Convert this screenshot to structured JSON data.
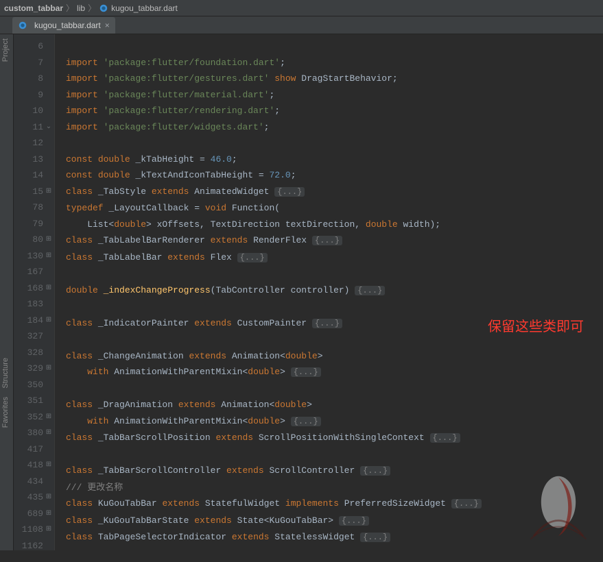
{
  "breadcrumb": {
    "root": "custom_tabbar",
    "folder": "lib",
    "file": "kugou_tabbar.dart"
  },
  "tab": {
    "label": "kugou_tabbar.dart"
  },
  "sideTools": {
    "project": "Project",
    "structure": "Structure",
    "favorites": "Favorites"
  },
  "annotation": "保留这些类即可",
  "lines": [
    {
      "num": "6",
      "fold": "",
      "segs": []
    },
    {
      "num": "7",
      "fold": "",
      "segs": [
        {
          "c": "kwd",
          "t": "import "
        },
        {
          "c": "str",
          "t": "'package:flutter/foundation.dart'"
        },
        {
          "c": "punct",
          "t": ";"
        }
      ]
    },
    {
      "num": "8",
      "fold": "",
      "segs": [
        {
          "c": "kwd",
          "t": "import "
        },
        {
          "c": "str",
          "t": "'package:flutter/gestures.dart'"
        },
        {
          "c": "kwd",
          "t": " show "
        },
        {
          "c": "typ",
          "t": "DragStartBehavior"
        },
        {
          "c": "punct",
          "t": ";"
        }
      ]
    },
    {
      "num": "9",
      "fold": "",
      "segs": [
        {
          "c": "kwd",
          "t": "import "
        },
        {
          "c": "str",
          "t": "'package:flutter/material.dart'"
        },
        {
          "c": "punct",
          "t": ";"
        }
      ]
    },
    {
      "num": "10",
      "fold": "",
      "segs": [
        {
          "c": "kwd",
          "t": "import "
        },
        {
          "c": "str",
          "t": "'package:flutter/rendering.dart'"
        },
        {
          "c": "punct",
          "t": ";"
        }
      ]
    },
    {
      "num": "11",
      "fold": "⌄",
      "segs": [
        {
          "c": "kwd",
          "t": "import "
        },
        {
          "c": "str",
          "t": "'package:flutter/widgets.dart'"
        },
        {
          "c": "punct",
          "t": ";"
        }
      ]
    },
    {
      "num": "12",
      "fold": "",
      "segs": []
    },
    {
      "num": "13",
      "fold": "",
      "segs": [
        {
          "c": "kwd",
          "t": "const "
        },
        {
          "c": "kwd",
          "t": "double "
        },
        {
          "c": "typ",
          "t": "_kTabHeight = "
        },
        {
          "c": "num",
          "t": "46.0"
        },
        {
          "c": "punct",
          "t": ";"
        }
      ]
    },
    {
      "num": "14",
      "fold": "",
      "segs": [
        {
          "c": "kwd",
          "t": "const "
        },
        {
          "c": "kwd",
          "t": "double "
        },
        {
          "c": "typ",
          "t": "_kTextAndIconTabHeight = "
        },
        {
          "c": "num",
          "t": "72.0"
        },
        {
          "c": "punct",
          "t": ";"
        }
      ]
    },
    {
      "num": "15",
      "fold": "⊞",
      "segs": [
        {
          "c": "kwd",
          "t": "class "
        },
        {
          "c": "typ",
          "t": "_TabStyle "
        },
        {
          "c": "kwd",
          "t": "extends "
        },
        {
          "c": "typ",
          "t": "AnimatedWidget "
        },
        {
          "c": "fold",
          "t": "{...}"
        }
      ]
    },
    {
      "num": "78",
      "fold": "",
      "segs": [
        {
          "c": "kwd",
          "t": "typedef "
        },
        {
          "c": "typ",
          "t": "_LayoutCallback = "
        },
        {
          "c": "kwd",
          "t": "void "
        },
        {
          "c": "typ",
          "t": "Function("
        }
      ]
    },
    {
      "num": "79",
      "fold": "",
      "segs": [
        {
          "c": "typ",
          "t": "    List<"
        },
        {
          "c": "kwd",
          "t": "double"
        },
        {
          "c": "typ",
          "t": "> xOffsets, TextDirection textDirection, "
        },
        {
          "c": "kwd",
          "t": "double "
        },
        {
          "c": "typ",
          "t": "width);"
        }
      ]
    },
    {
      "num": "80",
      "fold": "⊞",
      "segs": [
        {
          "c": "kwd",
          "t": "class "
        },
        {
          "c": "typ",
          "t": "_TabLabelBarRenderer "
        },
        {
          "c": "kwd",
          "t": "extends "
        },
        {
          "c": "typ",
          "t": "RenderFlex "
        },
        {
          "c": "fold",
          "t": "{...}"
        }
      ]
    },
    {
      "num": "130",
      "fold": "⊞",
      "segs": [
        {
          "c": "kwd",
          "t": "class "
        },
        {
          "c": "typ",
          "t": "_TabLabelBar "
        },
        {
          "c": "kwd",
          "t": "extends "
        },
        {
          "c": "typ",
          "t": "Flex "
        },
        {
          "c": "fold",
          "t": "{...}"
        }
      ]
    },
    {
      "num": "167",
      "fold": "",
      "segs": []
    },
    {
      "num": "168",
      "fold": "⊞",
      "segs": [
        {
          "c": "kwd",
          "t": "double "
        },
        {
          "c": "fn",
          "t": "_indexChangeProgress"
        },
        {
          "c": "typ",
          "t": "(TabController controller) "
        },
        {
          "c": "fold",
          "t": "{...}"
        }
      ]
    },
    {
      "num": "183",
      "fold": "",
      "segs": []
    },
    {
      "num": "184",
      "fold": "⊞",
      "segs": [
        {
          "c": "kwd",
          "t": "class "
        },
        {
          "c": "typ",
          "t": "_IndicatorPainter "
        },
        {
          "c": "kwd",
          "t": "extends "
        },
        {
          "c": "typ",
          "t": "CustomPainter "
        },
        {
          "c": "fold",
          "t": "{...}"
        }
      ]
    },
    {
      "num": "327",
      "fold": "",
      "segs": []
    },
    {
      "num": "328",
      "fold": "",
      "segs": [
        {
          "c": "kwd",
          "t": "class "
        },
        {
          "c": "typ",
          "t": "_ChangeAnimation "
        },
        {
          "c": "kwd",
          "t": "extends "
        },
        {
          "c": "typ",
          "t": "Animation<"
        },
        {
          "c": "kwd",
          "t": "double"
        },
        {
          "c": "typ",
          "t": ">"
        }
      ]
    },
    {
      "num": "329",
      "fold": "⊞",
      "segs": [
        {
          "c": "typ",
          "t": "    "
        },
        {
          "c": "kwd",
          "t": "with "
        },
        {
          "c": "typ",
          "t": "AnimationWithParentMixin<"
        },
        {
          "c": "kwd",
          "t": "double"
        },
        {
          "c": "typ",
          "t": "> "
        },
        {
          "c": "fold",
          "t": "{...}"
        }
      ]
    },
    {
      "num": "350",
      "fold": "",
      "segs": []
    },
    {
      "num": "351",
      "fold": "",
      "segs": [
        {
          "c": "kwd",
          "t": "class "
        },
        {
          "c": "typ",
          "t": "_DragAnimation "
        },
        {
          "c": "kwd",
          "t": "extends "
        },
        {
          "c": "typ",
          "t": "Animation<"
        },
        {
          "c": "kwd",
          "t": "double"
        },
        {
          "c": "typ",
          "t": ">"
        }
      ]
    },
    {
      "num": "352",
      "fold": "⊞",
      "segs": [
        {
          "c": "typ",
          "t": "    "
        },
        {
          "c": "kwd",
          "t": "with "
        },
        {
          "c": "typ",
          "t": "AnimationWithParentMixin<"
        },
        {
          "c": "kwd",
          "t": "double"
        },
        {
          "c": "typ",
          "t": "> "
        },
        {
          "c": "fold",
          "t": "{...}"
        }
      ]
    },
    {
      "num": "380",
      "fold": "⊞",
      "segs": [
        {
          "c": "kwd",
          "t": "class "
        },
        {
          "c": "typ",
          "t": "_TabBarScrollPosition "
        },
        {
          "c": "kwd",
          "t": "extends "
        },
        {
          "c": "typ",
          "t": "ScrollPositionWithSingleContext "
        },
        {
          "c": "fold",
          "t": "{...}"
        }
      ]
    },
    {
      "num": "417",
      "fold": "",
      "segs": []
    },
    {
      "num": "418",
      "fold": "⊞",
      "segs": [
        {
          "c": "kwd",
          "t": "class "
        },
        {
          "c": "typ",
          "t": "_TabBarScrollController "
        },
        {
          "c": "kwd",
          "t": "extends "
        },
        {
          "c": "typ",
          "t": "ScrollController "
        },
        {
          "c": "fold",
          "t": "{...}"
        }
      ]
    },
    {
      "num": "434",
      "fold": "",
      "segs": [
        {
          "c": "cmt",
          "t": "/// 更改名称"
        }
      ]
    },
    {
      "num": "435",
      "fold": "⊞",
      "segs": [
        {
          "c": "kwd",
          "t": "class "
        },
        {
          "c": "typ",
          "t": "KuGouTabBar "
        },
        {
          "c": "kwd",
          "t": "extends "
        },
        {
          "c": "typ",
          "t": "StatefulWidget "
        },
        {
          "c": "kwd",
          "t": "implements "
        },
        {
          "c": "typ",
          "t": "PreferredSizeWidget "
        },
        {
          "c": "fold",
          "t": "{...}"
        }
      ]
    },
    {
      "num": "689",
      "fold": "⊞",
      "segs": [
        {
          "c": "kwd",
          "t": "class "
        },
        {
          "c": "typ",
          "t": "_KuGouTabBarState "
        },
        {
          "c": "kwd",
          "t": "extends "
        },
        {
          "c": "typ",
          "t": "State<KuGouTabBar> "
        },
        {
          "c": "fold",
          "t": "{...}"
        }
      ]
    },
    {
      "num": "1108",
      "fold": "⊞",
      "segs": [
        {
          "c": "kwd",
          "t": "class "
        },
        {
          "c": "typ",
          "t": "TabPageSelectorIndicator "
        },
        {
          "c": "kwd",
          "t": "extends "
        },
        {
          "c": "typ",
          "t": "StatelessWidget "
        },
        {
          "c": "fold",
          "t": "{...}"
        }
      ]
    },
    {
      "num": "1162",
      "fold": "",
      "segs": []
    }
  ]
}
